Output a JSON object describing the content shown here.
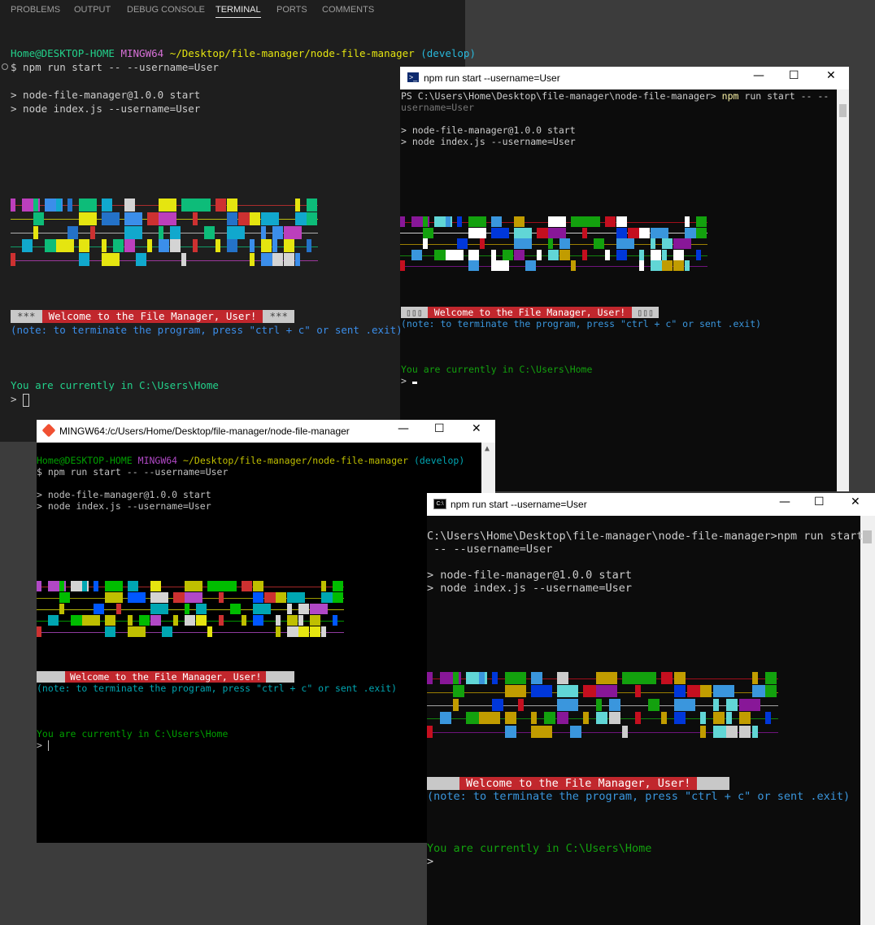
{
  "vscode": {
    "tabs": [
      "PROBLEMS",
      "OUTPUT",
      "DEBUG CONSOLE",
      "TERMINAL",
      "PORTS",
      "COMMENTS"
    ],
    "active_tab": "TERMINAL",
    "prompt_user": "Home@DESKTOP-HOME",
    "prompt_shell": "MINGW64",
    "prompt_path": "~/Desktop/file-manager/node-file-manager",
    "prompt_branch": "(develop)",
    "command": "$ npm run start -- --username=User",
    "out1": "> node-file-manager@1.0.0 start",
    "out2": "> node index.js --username=User",
    "welcome_left": "***",
    "welcome": "Welcome to the File Manager, User!",
    "welcome_right": "***",
    "note": "(note: to terminate the program, press \"ctrl + c\" or sent .exit)",
    "current": "You are currently in C:\\Users\\Home",
    "caret": ">"
  },
  "powershell": {
    "title": "npm run start --username=User",
    "prompt": "PS C:\\Users\\Home\\Desktop\\file-manager\\node-file-manager>",
    "cmd_npm": "npm",
    "cmd_rest": "run start -- --",
    "cmd_wrap": "username=User",
    "out1": "> node-file-manager@1.0.0 start",
    "out2": "> node index.js --username=User",
    "welcome_left": "▯▯▯",
    "welcome": "Welcome to the File Manager, User!",
    "welcome_right": "▯▯▯",
    "note": "(note: to terminate the program, press \"ctrl + c\" or sent .exit)",
    "current": "You are currently in C:\\Users\\Home",
    "caret": ">"
  },
  "mingw": {
    "title": "MINGW64:/c/Users/Home/Desktop/file-manager/node-file-manager",
    "prompt_user": "Home@DESKTOP-HOME",
    "prompt_shell": "MINGW64",
    "prompt_path": "~/Desktop/file-manager/node-file-manager",
    "prompt_branch": "(develop)",
    "command": "$ npm run start -- --username=User",
    "out1": "> node-file-manager@1.0.0 start",
    "out2": "> node index.js --username=User",
    "welcome": "Welcome to the File Manager, User!",
    "note": "(note: to terminate the program, press \"ctrl + c\" or sent .exit)",
    "current": "You are currently in C:\\Users\\Home",
    "caret": ">"
  },
  "cmd": {
    "title": "npm run start --username=User",
    "prompt_line": "C:\\Users\\Home\\Desktop\\file-manager\\node-file-manager>npm run start",
    "prompt_wrap": " -- --username=User",
    "out1": "> node-file-manager@1.0.0 start",
    "out2": "> node index.js --username=User",
    "welcome": "Welcome to the File Manager, User!",
    "note": "(note: to terminate the program, press \"ctrl + c\" or sent .exit)",
    "current": "You are currently in C:\\Users\\Home",
    "caret": ">"
  },
  "window_controls": {
    "minimize": "—",
    "maximize": "☐",
    "close": "✕"
  },
  "colors": {
    "vs_bg": "#1e1e1e",
    "term_bg": "#0c0c0c",
    "green": "#23d18b",
    "magenta": "#bc3fbc",
    "yellow": "#e5e510",
    "blue": "#2472c8",
    "teal": "#11a8cd",
    "red": "#c1272d",
    "grey": "#c8c8c8"
  }
}
